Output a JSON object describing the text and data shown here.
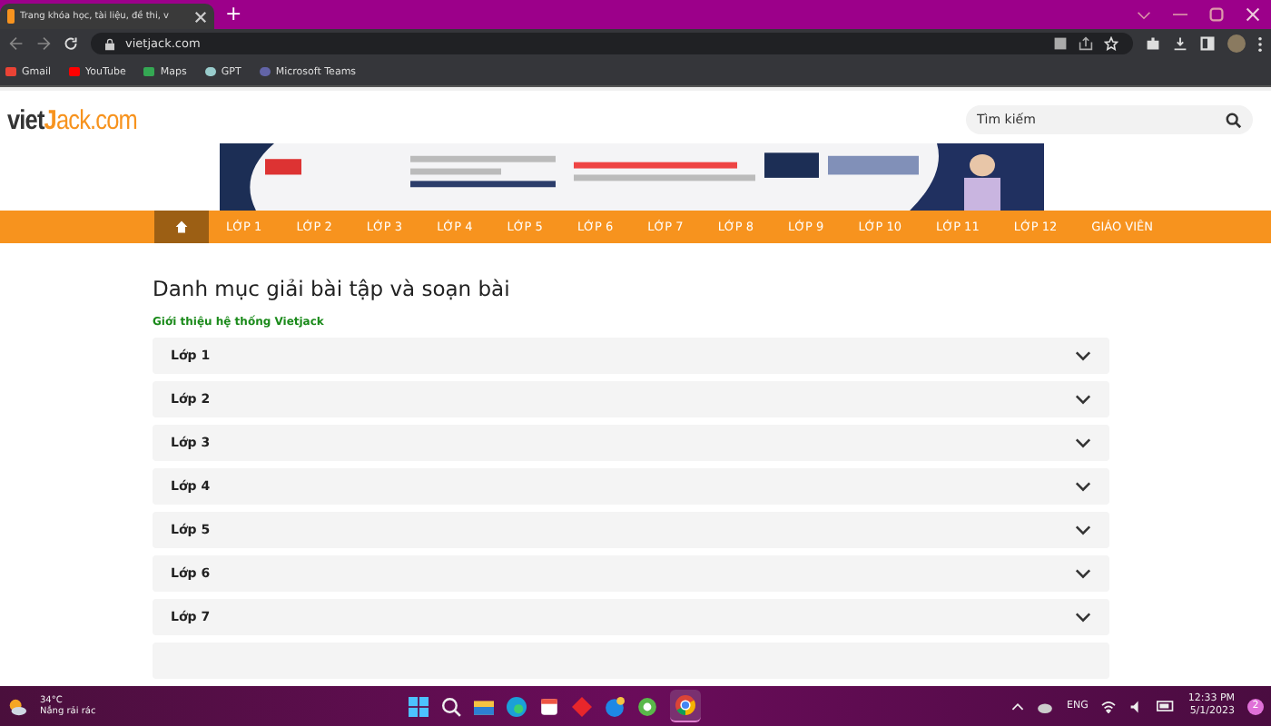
{
  "browser": {
    "tab_title": "Trang khóa học, tài liệu, đề thi, v",
    "new_tab": "+",
    "url": "vietjack.com",
    "bookmarks": [
      {
        "label": "Gmail"
      },
      {
        "label": "YouTube"
      },
      {
        "label": "Maps"
      },
      {
        "label": "GPT"
      },
      {
        "label": "Microsoft Teams"
      }
    ]
  },
  "site": {
    "logo_a": "viet",
    "logo_b": "J",
    "logo_c": "ack.com",
    "search": {
      "placeholder": "Tìm kiếm"
    },
    "nav": [
      {
        "kind": "home",
        "selected": true
      },
      {
        "label": "LỚP 1",
        "kind": "link",
        "selected": false
      },
      {
        "label": "LỚP 2",
        "kind": "link",
        "selected": false
      },
      {
        "label": "LỚP 3",
        "kind": "link",
        "selected": false
      },
      {
        "label": "LỚP 4",
        "kind": "link",
        "selected": false
      },
      {
        "label": "LỚP 5",
        "kind": "link",
        "selected": false
      },
      {
        "label": "LỚP 6",
        "kind": "link",
        "selected": false
      },
      {
        "label": "LỚP 7",
        "kind": "link",
        "selected": false
      },
      {
        "label": "LỚP 8",
        "kind": "link",
        "selected": false
      },
      {
        "label": "LỚP 9",
        "kind": "link",
        "selected": false
      },
      {
        "label": "LỚP 10",
        "kind": "link",
        "selected": false
      },
      {
        "label": "LỚP 11",
        "kind": "link",
        "selected": false
      },
      {
        "label": "LỚP 12",
        "kind": "link",
        "selected": false
      },
      {
        "label": "GIÁO VIÊN",
        "kind": "link",
        "selected": false
      }
    ],
    "heading": "Danh mục giải bài tập và soạn bài",
    "intro_link": "Giới thiệu hệ thống Vietjack",
    "sections": [
      {
        "label": "Lớp 1",
        "expanded": false
      },
      {
        "label": "Lớp 2",
        "expanded": false
      },
      {
        "label": "Lớp 3",
        "expanded": false
      },
      {
        "label": "Lớp 4",
        "expanded": false
      },
      {
        "label": "Lớp 5",
        "expanded": false
      },
      {
        "label": "Lớp 6",
        "expanded": false
      },
      {
        "label": "Lớp 7",
        "expanded": false
      }
    ]
  },
  "taskbar": {
    "temperature": "34°C",
    "weather": "Nắng rải rác",
    "language": "ENG",
    "time": "12:33 PM",
    "date": "5/1/2023",
    "notifications": "2"
  }
}
